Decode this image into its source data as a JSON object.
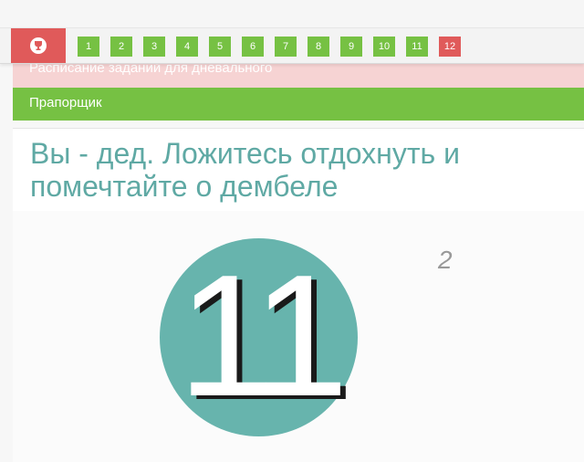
{
  "levels": {
    "items": [
      {
        "label": "1",
        "state": "done"
      },
      {
        "label": "2",
        "state": "done"
      },
      {
        "label": "3",
        "state": "done"
      },
      {
        "label": "4",
        "state": "done"
      },
      {
        "label": "5",
        "state": "done"
      },
      {
        "label": "6",
        "state": "done"
      },
      {
        "label": "7",
        "state": "done"
      },
      {
        "label": "8",
        "state": "done"
      },
      {
        "label": "9",
        "state": "done"
      },
      {
        "label": "10",
        "state": "done"
      },
      {
        "label": "11",
        "state": "done"
      },
      {
        "label": "12",
        "state": "current"
      }
    ],
    "trophy_icon": "trophy-icon"
  },
  "notice": {
    "text": "Расписание заданий для дневального"
  },
  "rank": {
    "label": "Прапорщик"
  },
  "task": {
    "title": "Вы - дед. Ложитесь отдохнуть и помечтайте о дембеле"
  },
  "counter": {
    "big_number": "11",
    "side_number": "2"
  },
  "colors": {
    "done": "#76c143",
    "current": "#e05a5a",
    "trophy_bg": "#e05a5a",
    "rank_bar": "#76c143",
    "notice_bg": "#f6d3d3",
    "title_text": "#5fa9a4",
    "circle": "#67b4ad"
  }
}
